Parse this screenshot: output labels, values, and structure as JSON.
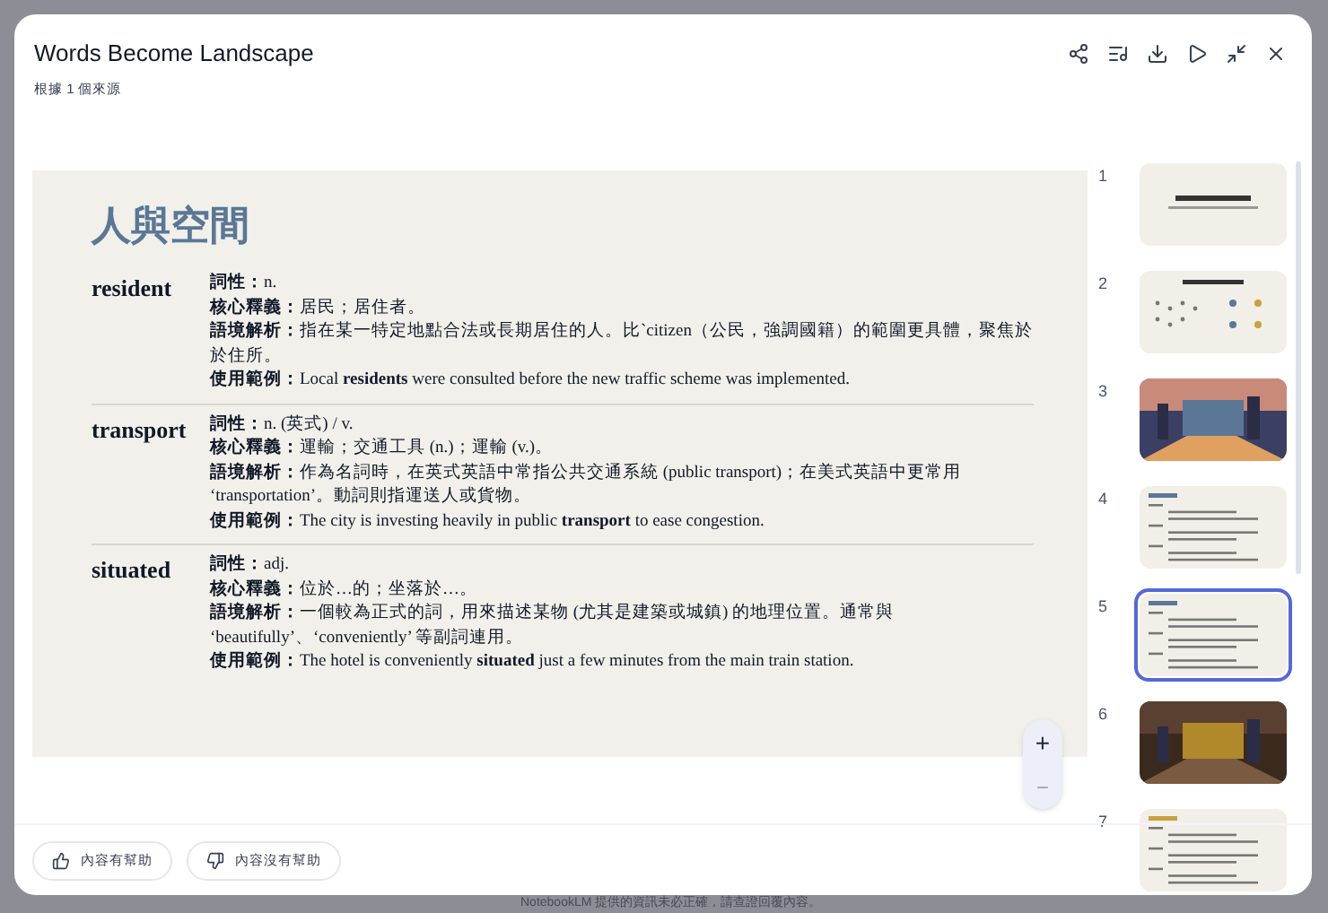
{
  "dialog": {
    "title": "Words Become Landscape",
    "subtitle": "根據 1 個來源"
  },
  "slide": {
    "heading": "人與空間",
    "entries": [
      {
        "word": "resident",
        "lines": [
          "**詞性：**n.",
          "**核心釋義：**居民；居住者。",
          "**語境解析：**指在某一特定地點合法或長期居住的人。比`citizen（公民，強調國籍）的範圍更具體，聚焦於於住所。",
          "**使用範例：**Local **residents** were consulted before the new traffic scheme was implemented."
        ]
      },
      {
        "word": "transport",
        "lines": [
          "**詞性：**n. (英式) / v.",
          "**核心釋義：**運輸；交通工具 (n.)；運輸 (v.)。",
          "**語境解析：**作為名詞時，在英式英語中常指公共交通系統 (public transport)；在美式英語中更常用 ‘transportation’。動詞則指運送人或貨物。",
          "**使用範例：**The city is investing heavily in public **transport** to ease congestion."
        ]
      },
      {
        "word": "situated",
        "lines": [
          "**詞性：**adj.",
          "**核心釋義：**位於…的；坐落於…。",
          "**語境解析：**一個較為正式的詞，用來描述某物 (尤其是建築或城鎮) 的地理位置。通常與 ‘beautifully’、‘conveniently’ 等副詞連用。",
          "**使用範例：**The hotel is conveniently **situated** just a few minutes from the main train station."
        ]
      }
    ]
  },
  "zoom": {
    "in": "+",
    "out": "−"
  },
  "thumbnails": [
    {
      "number": "1",
      "kind": "title",
      "selected": false
    },
    {
      "number": "2",
      "kind": "diagram",
      "selected": false
    },
    {
      "number": "3",
      "kind": "picture",
      "selected": false
    },
    {
      "number": "4",
      "kind": "text",
      "selected": false
    },
    {
      "number": "5",
      "kind": "text",
      "selected": true
    },
    {
      "number": "6",
      "kind": "picture",
      "selected": false
    },
    {
      "number": "7",
      "kind": "text",
      "selected": false
    }
  ],
  "feedback": [
    "內容有幫助",
    "內容沒有幫助"
  ],
  "disclaimer": "NotebookLM 提供的資訊未必正確，請查證回覆內容。"
}
